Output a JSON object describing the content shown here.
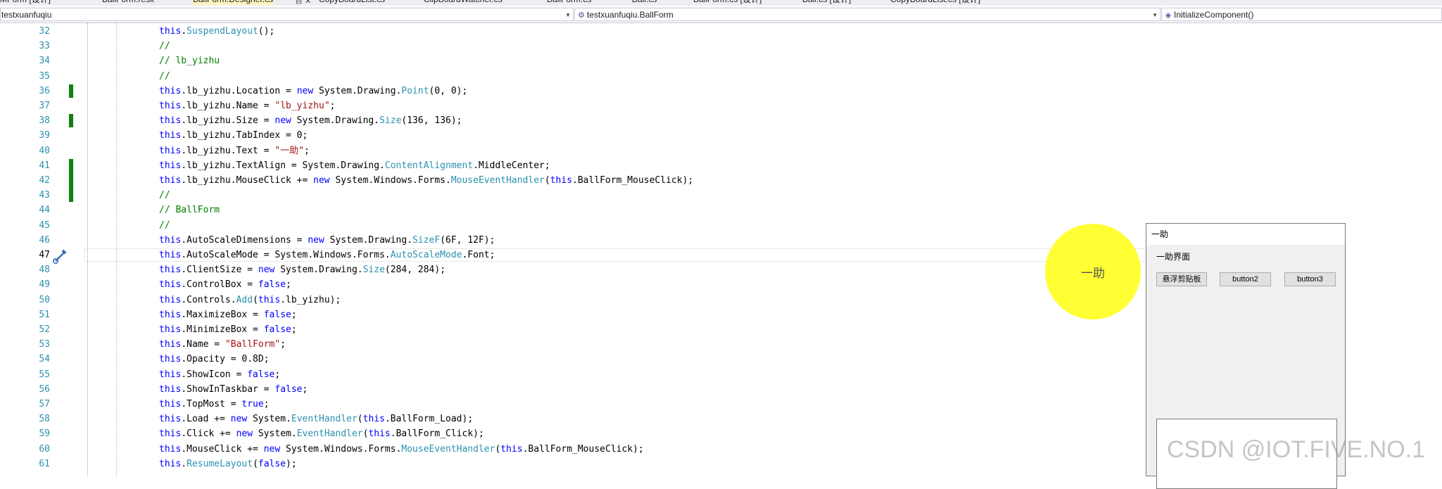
{
  "tabs": [
    {
      "label": "MForm [设计]",
      "active": false
    },
    {
      "label": "BallForm.resx",
      "active": false
    },
    {
      "label": "BallForm.Designer.cs",
      "active": true
    },
    {
      "label": "CopyBoardList.cs",
      "active": false
    },
    {
      "label": "ClipBoardWatcher.cs",
      "active": false
    },
    {
      "label": "BallForm.cs",
      "active": false
    },
    {
      "label": "Ball.cs",
      "active": false
    },
    {
      "label": "BallForm.cs [设计]",
      "active": false
    },
    {
      "label": "Ball.cs [设计]",
      "active": false
    },
    {
      "label": "CopyBoardList.cs [设计]",
      "active": false
    }
  ],
  "tab_actions": {
    "pin": "⊟",
    "close": "✕"
  },
  "navbar": {
    "project": "testxuanfuqiu",
    "type": "testxuanfuqiu.BallForm",
    "member": "InitializeComponent()",
    "type_icon": "class-icon",
    "member_icon": "method-icon"
  },
  "editor": {
    "line_numbers": [
      "32",
      "33",
      "34",
      "35",
      "36",
      "37",
      "38",
      "39",
      "40",
      "41",
      "42",
      "43",
      "44",
      "45",
      "46",
      "47",
      "48",
      "49",
      "50",
      "51",
      "52",
      "53",
      "54",
      "55",
      "56",
      "57",
      "58",
      "59",
      "60",
      "61"
    ],
    "current_line": "47",
    "code": [
      [
        [
          "kw",
          "this"
        ],
        [
          "",
          "."
        ],
        [
          "ty",
          "SuspendLayout"
        ],
        [
          "",
          "();"
        ]
      ],
      [
        [
          "cm",
          "//"
        ]
      ],
      [
        [
          "cm",
          "// lb_yizhu"
        ]
      ],
      [
        [
          "cm",
          "//"
        ]
      ],
      [
        [
          "kw",
          "this"
        ],
        [
          "",
          ".lb_yizhu.Location = "
        ],
        [
          "kw",
          "new"
        ],
        [
          "",
          " System.Drawing."
        ],
        [
          "ty",
          "Point"
        ],
        [
          "",
          "(0, 0);"
        ]
      ],
      [
        [
          "kw",
          "this"
        ],
        [
          "",
          ".lb_yizhu.Name = "
        ],
        [
          "str",
          "\"lb_yizhu\""
        ],
        [
          "",
          ";"
        ]
      ],
      [
        [
          "kw",
          "this"
        ],
        [
          "",
          ".lb_yizhu.Size = "
        ],
        [
          "kw",
          "new"
        ],
        [
          "",
          " System.Drawing."
        ],
        [
          "ty",
          "Size"
        ],
        [
          "",
          "(136, 136);"
        ]
      ],
      [
        [
          "kw",
          "this"
        ],
        [
          "",
          ".lb_yizhu.TabIndex = 0;"
        ]
      ],
      [
        [
          "kw",
          "this"
        ],
        [
          "",
          ".lb_yizhu.Text = "
        ],
        [
          "str",
          "\"一助\""
        ],
        [
          "",
          ";"
        ]
      ],
      [
        [
          "kw",
          "this"
        ],
        [
          "",
          ".lb_yizhu.TextAlign = System.Drawing."
        ],
        [
          "ty",
          "ContentAlignment"
        ],
        [
          "",
          ".MiddleCenter;"
        ]
      ],
      [
        [
          "kw",
          "this"
        ],
        [
          "",
          ".lb_yizhu.MouseClick += "
        ],
        [
          "kw",
          "new"
        ],
        [
          "",
          " System.Windows.Forms."
        ],
        [
          "ty",
          "MouseEventHandler"
        ],
        [
          "",
          "("
        ],
        [
          "kw",
          "this"
        ],
        [
          "",
          ".BallForm_MouseClick);"
        ]
      ],
      [
        [
          "cm",
          "//"
        ]
      ],
      [
        [
          "cm",
          "// BallForm"
        ]
      ],
      [
        [
          "cm",
          "//"
        ]
      ],
      [
        [
          "kw",
          "this"
        ],
        [
          "",
          ".AutoScaleDimensions = "
        ],
        [
          "kw",
          "new"
        ],
        [
          "",
          " System.Drawing."
        ],
        [
          "ty",
          "SizeF"
        ],
        [
          "",
          "(6F, 12F);"
        ]
      ],
      [
        [
          "kw",
          "this"
        ],
        [
          "",
          ".AutoScaleMode = System.Windows.Forms."
        ],
        [
          "ty",
          "AutoScaleMode"
        ],
        [
          "",
          ".Font;"
        ]
      ],
      [
        [
          "kw",
          "this"
        ],
        [
          "",
          ".ClientSize = "
        ],
        [
          "kw",
          "new"
        ],
        [
          "",
          " System.Drawing."
        ],
        [
          "ty",
          "Size"
        ],
        [
          "",
          "(284, 284);"
        ]
      ],
      [
        [
          "kw",
          "this"
        ],
        [
          "",
          ".ControlBox = "
        ],
        [
          "kw",
          "false"
        ],
        [
          "",
          ";"
        ]
      ],
      [
        [
          "kw",
          "this"
        ],
        [
          "",
          ".Controls."
        ],
        [
          "ty",
          "Add"
        ],
        [
          "",
          "("
        ],
        [
          "kw",
          "this"
        ],
        [
          "",
          ".lb_yizhu);"
        ]
      ],
      [
        [
          "kw",
          "this"
        ],
        [
          "",
          ".MaximizeBox = "
        ],
        [
          "kw",
          "false"
        ],
        [
          "",
          ";"
        ]
      ],
      [
        [
          "kw",
          "this"
        ],
        [
          "",
          ".MinimizeBox = "
        ],
        [
          "kw",
          "false"
        ],
        [
          "",
          ";"
        ]
      ],
      [
        [
          "kw",
          "this"
        ],
        [
          "",
          ".Name = "
        ],
        [
          "str",
          "\"BallForm\""
        ],
        [
          "",
          ";"
        ]
      ],
      [
        [
          "kw",
          "this"
        ],
        [
          "",
          ".Opacity = 0.8D;"
        ]
      ],
      [
        [
          "kw",
          "this"
        ],
        [
          "",
          ".ShowIcon = "
        ],
        [
          "kw",
          "false"
        ],
        [
          "",
          ";"
        ]
      ],
      [
        [
          "kw",
          "this"
        ],
        [
          "",
          ".ShowInTaskbar = "
        ],
        [
          "kw",
          "false"
        ],
        [
          "",
          ";"
        ]
      ],
      [
        [
          "kw",
          "this"
        ],
        [
          "",
          ".TopMost = "
        ],
        [
          "kw",
          "true"
        ],
        [
          "",
          ";"
        ]
      ],
      [
        [
          "kw",
          "this"
        ],
        [
          "",
          ".Load += "
        ],
        [
          "kw",
          "new"
        ],
        [
          "",
          " System."
        ],
        [
          "ty",
          "EventHandler"
        ],
        [
          "",
          "("
        ],
        [
          "kw",
          "this"
        ],
        [
          "",
          ".BallForm_Load);"
        ]
      ],
      [
        [
          "kw",
          "this"
        ],
        [
          "",
          ".Click += "
        ],
        [
          "kw",
          "new"
        ],
        [
          "",
          " System."
        ],
        [
          "ty",
          "EventHandler"
        ],
        [
          "",
          "("
        ],
        [
          "kw",
          "this"
        ],
        [
          "",
          ".BallForm_Click);"
        ]
      ],
      [
        [
          "kw",
          "this"
        ],
        [
          "",
          ".MouseClick += "
        ],
        [
          "kw",
          "new"
        ],
        [
          "",
          " System.Windows.Forms."
        ],
        [
          "ty",
          "MouseEventHandler"
        ],
        [
          "",
          "("
        ],
        [
          "kw",
          "this"
        ],
        [
          "",
          ".BallForm_MouseClick);"
        ]
      ],
      [
        [
          "kw",
          "this"
        ],
        [
          "",
          "."
        ],
        [
          "ty",
          "ResumeLayout"
        ],
        [
          "",
          "("
        ],
        [
          "kw",
          "false"
        ],
        [
          "",
          ");"
        ]
      ]
    ]
  },
  "ball": {
    "text": "一助",
    "color": "#ffff33"
  },
  "form": {
    "title": "一助",
    "label": "一助界面",
    "buttons": [
      "悬浮剪贴板",
      "button2",
      "button3"
    ]
  },
  "watermark": "CSDN @IOT.FIVE.NO.1",
  "colors": {
    "keyword": "#0000ff",
    "type": "#2b91af",
    "string": "#a31515",
    "comment": "#008000",
    "change_bar": "#108010"
  }
}
